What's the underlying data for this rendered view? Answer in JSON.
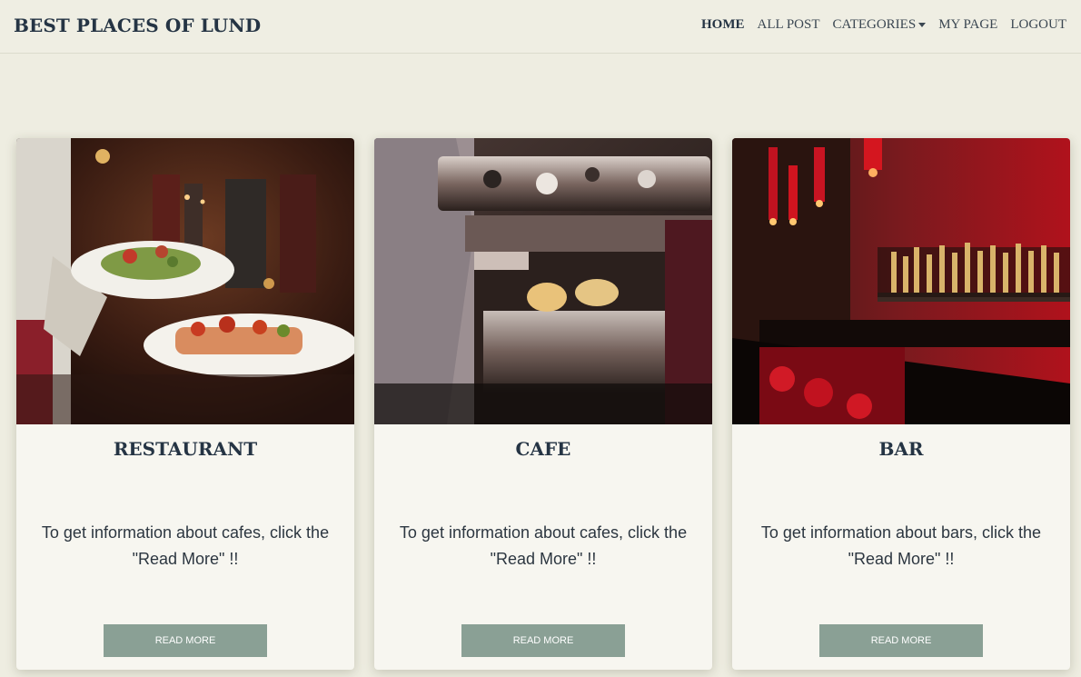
{
  "header": {
    "brand": "BEST PLACES OF LUND",
    "nav": [
      {
        "label": "HOME"
      },
      {
        "label": "ALL POST"
      },
      {
        "label": "CATEGORIES"
      },
      {
        "label": "MY PAGE"
      },
      {
        "label": "LOGOUT"
      }
    ]
  },
  "cards": [
    {
      "title": "RESTAURANT",
      "description": "To get information about cafes, click the \"Read More\" !!",
      "button": "READ MORE",
      "image": "restaurant-photo"
    },
    {
      "title": "CAFE",
      "description": "To get information about cafes, click the \"Read More\" !!",
      "button": "READ MORE",
      "image": "cafe-photo"
    },
    {
      "title": "BAR",
      "description": "To get information about bars, click the \"Read More\" !!",
      "button": "READ MORE",
      "image": "bar-photo"
    }
  ],
  "colors": {
    "background": "#eeede1",
    "text": "#253444",
    "button": "#8aa095"
  }
}
